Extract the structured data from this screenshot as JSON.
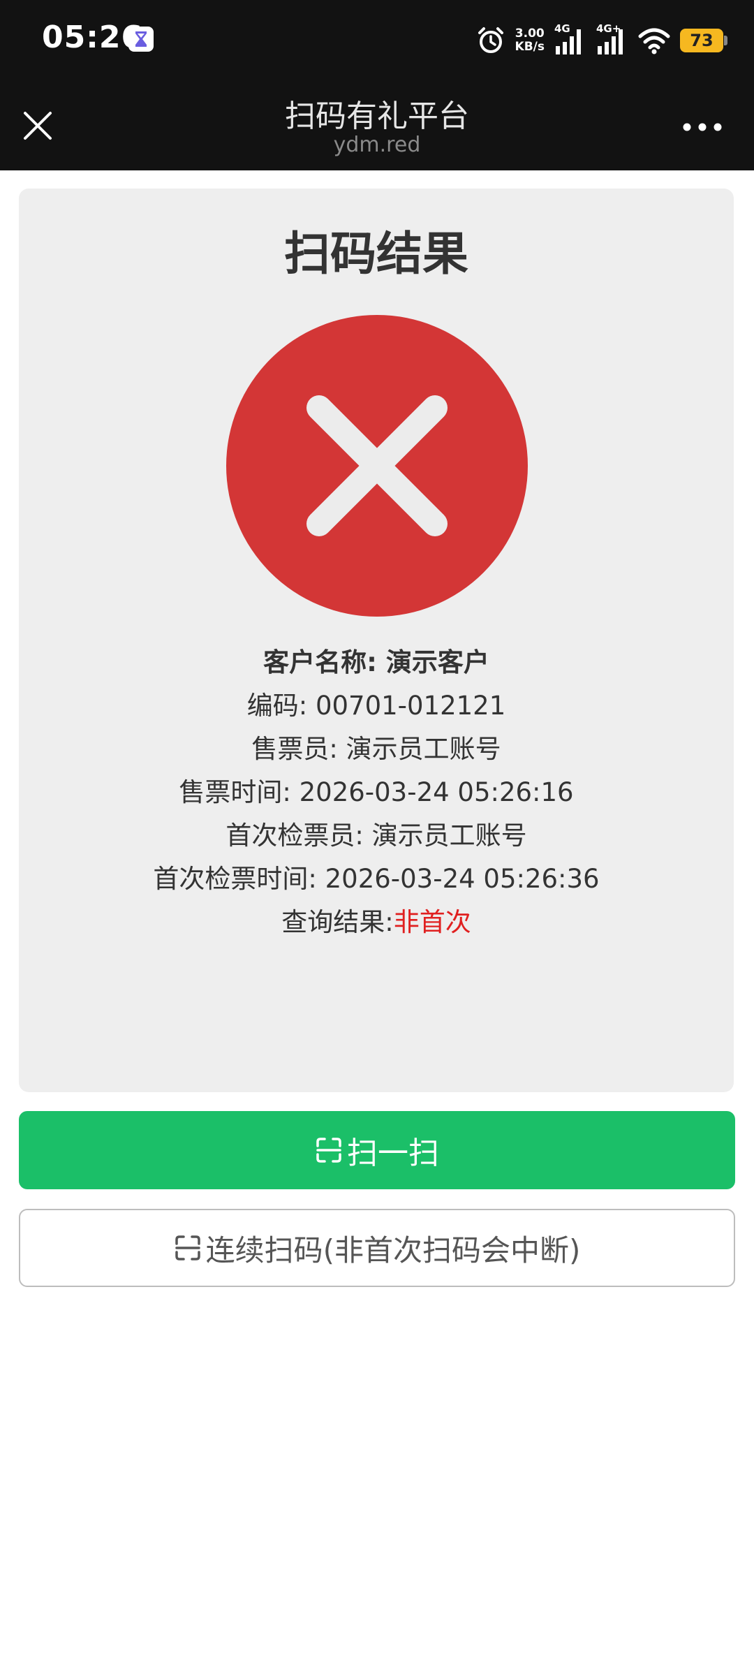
{
  "status_bar": {
    "time": "05:26",
    "speed_value": "3.00",
    "speed_unit": "KB/s",
    "signal_1_label": "4G",
    "signal_2_label": "4G+",
    "battery": "73",
    "icons": [
      "hourglass-icon",
      "alarm-icon",
      "signal-icon",
      "wifi-icon",
      "battery-icon"
    ]
  },
  "nav": {
    "title": "扫码有礼平台",
    "subtitle": "ydm.red"
  },
  "result": {
    "title": "扫码结果",
    "status_icon": "fail-x-circle",
    "customer_line": "客户名称: 演示客户",
    "code_line": "编码: 00701-012121",
    "seller_line": "售票员: 演示员工账号",
    "sale_time_line": "售票时间: 2026-03-24 05:26:16",
    "first_checker_line": "首次检票员: 演示员工账号",
    "first_check_time_line": "首次检票时间: 2026-03-24 05:26:36",
    "query_label": "查询结果:",
    "query_value": "非首次"
  },
  "buttons": {
    "scan_label": "扫一扫",
    "continuous_label": "连续扫码(非首次扫码会中断)"
  },
  "colors": {
    "header_bg": "#121212",
    "card_bg": "#eeeeee",
    "fail_red": "#d33636",
    "accent_green": "#1bbf68",
    "query_red": "#e02020",
    "battery_yellow": "#f6b820"
  }
}
